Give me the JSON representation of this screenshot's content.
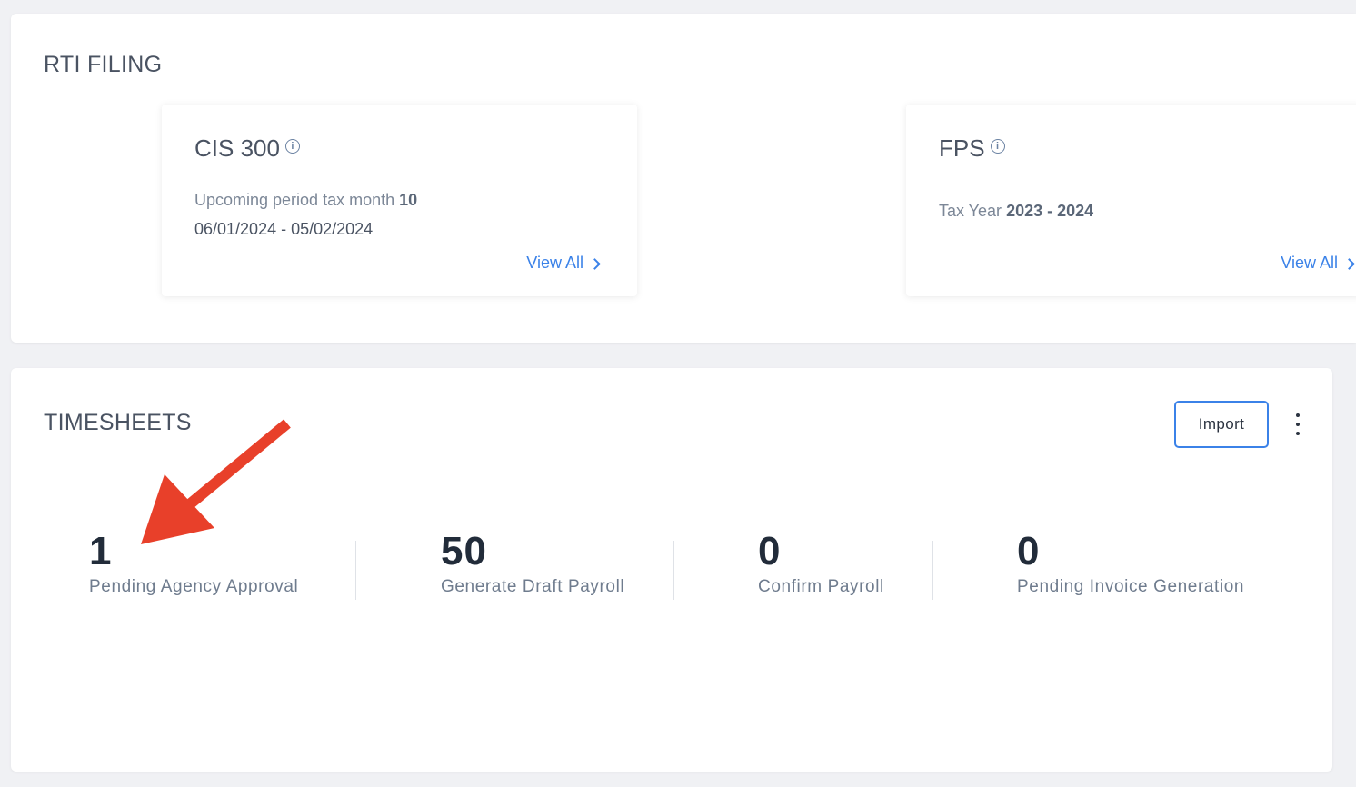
{
  "rti": {
    "title": "RTI FILING",
    "cis": {
      "title": "CIS 300",
      "upcoming_prefix": "Upcoming period tax month ",
      "tax_month": "10",
      "date_range": "06/01/2024 - 05/02/2024",
      "view_all": "View All"
    },
    "fps": {
      "title": "FPS",
      "tax_year_prefix": "Tax Year ",
      "tax_year": "2023 - 2024",
      "view_all": "View All"
    }
  },
  "timesheets": {
    "title": "TIMESHEETS",
    "import_label": "Import",
    "stats": [
      {
        "value": "1",
        "label": "Pending Agency Approval"
      },
      {
        "value": "50",
        "label": "Generate Draft Payroll"
      },
      {
        "value": "0",
        "label": "Confirm Payroll"
      },
      {
        "value": "0",
        "label": "Pending Invoice Generation"
      }
    ]
  },
  "annotation": {
    "arrow_color": "#e8402a"
  },
  "colors": {
    "accent": "#3b82e8",
    "text": "#4a5362"
  }
}
